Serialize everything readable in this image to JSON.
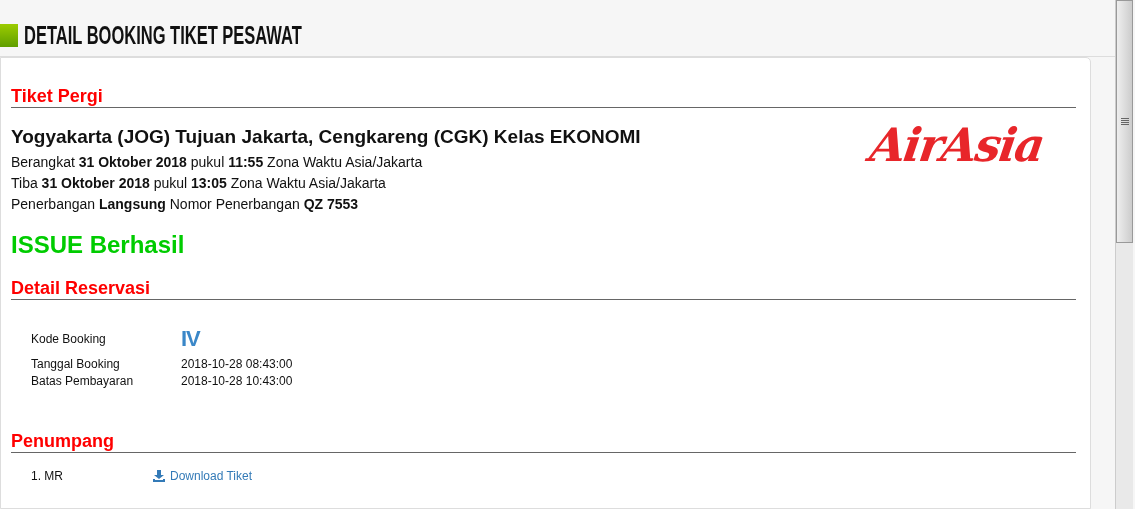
{
  "header": {
    "title": "DETAIL BOOKING TIKET PESAWAT"
  },
  "departure": {
    "heading": "Tiket Pergi",
    "route": "Yogyakarta (JOG) Tujuan Jakarta, Cengkareng (CGK) Kelas EKONOMI",
    "lines": [
      "Berangkat **31 Oktober 2018** pukul **11:55** Zona Waktu Asia/Jakarta",
      "Tiba **31 Oktober 2018** pukul **13:05** Zona Waktu Asia/Jakarta",
      "Penerbangan **Langsung** Nomor Penerbangan **QZ 7553**"
    ],
    "logo": "AirAsia"
  },
  "status": "ISSUE Berhasil",
  "reservation": {
    "heading": "Detail Reservasi",
    "rows": [
      {
        "label": "Kode Booking",
        "value": "IV",
        "kind": "code"
      },
      {
        "label": "Tanggal Booking",
        "value": "2018-10-28 08:43:00",
        "kind": "plain"
      },
      {
        "label": "Batas Pembayaran",
        "value": "2018-10-28 10:43:00",
        "kind": "plain"
      }
    ]
  },
  "passengers": {
    "heading": "Penumpang",
    "items": [
      {
        "name": "1. MR",
        "link": "Download Tiket"
      }
    ]
  }
}
